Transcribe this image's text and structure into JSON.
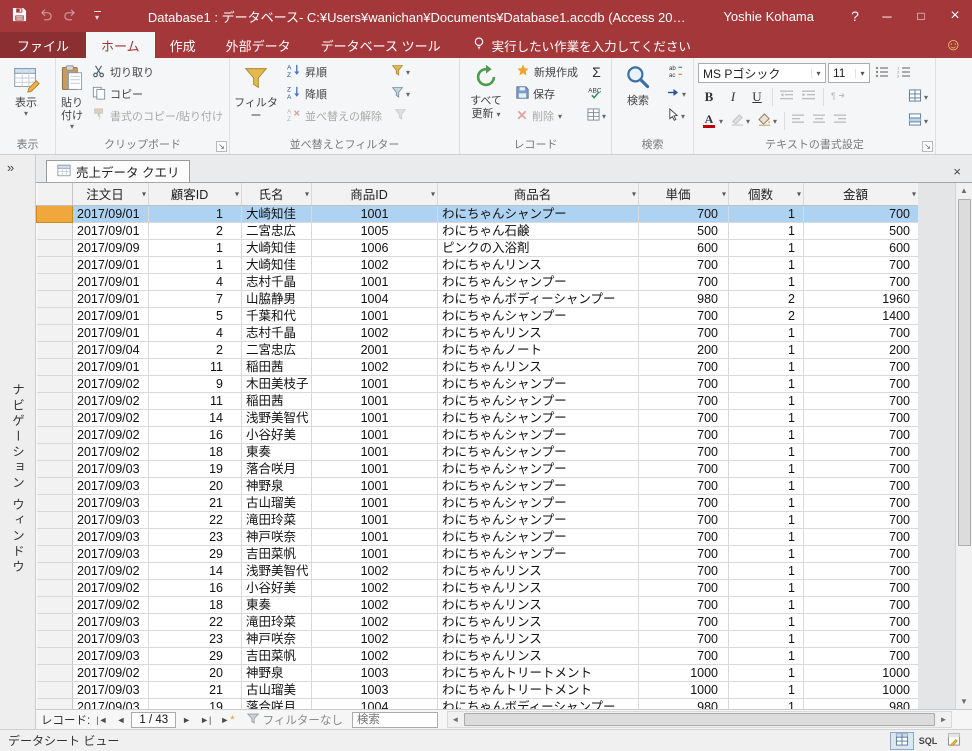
{
  "glyphs": {
    "dropdown": "▾",
    "up": "▲",
    "down": "▼",
    "left": "◄",
    "right": "►",
    "bar": "|",
    "launcher": "↘",
    "chevron_expand": "»",
    "smiley": "☺"
  },
  "titlebar": {
    "title": "Database1 : データベース- C:¥Users¥wanichan¥Documents¥Database1.accdb (Access 20…",
    "user": "Yoshie Kohama",
    "help": "?",
    "minimize": "─",
    "maximize": "□",
    "close": "×"
  },
  "ribbon": {
    "tabs": {
      "file": "ファイル",
      "home": "ホーム",
      "create": "作成",
      "external": "外部データ",
      "tools": "データベース ツール"
    },
    "tellme": "実行したい作業を入力してください",
    "view_group": {
      "label": "表示",
      "view": "表示"
    },
    "clipboard_group": {
      "label": "クリップボード",
      "paste": "貼り付け",
      "cut": "切り取り",
      "copy": "コピー",
      "format_painter": "書式のコピー/貼り付け"
    },
    "sort_group": {
      "label": "並べ替えとフィルター",
      "filter": "フィルター",
      "asc": "昇順",
      "desc": "降順",
      "clear": "並べ替えの解除"
    },
    "records_group": {
      "label": "レコード",
      "refresh1": "すべて",
      "refresh2": "更新",
      "new": "新規作成",
      "save": "保存",
      "delete": "削除",
      "sum": "Σ"
    },
    "find_group": {
      "label": "検索",
      "find": "検索"
    },
    "format_group": {
      "label": "テキストの書式設定",
      "font": "MS Pゴシック",
      "size": "11",
      "bold": "B",
      "italic": "I",
      "underline": "U",
      "color": "A"
    }
  },
  "nav_pane": {
    "expand": "»",
    "label": "ナビゲーション ウィンドウ"
  },
  "document": {
    "tab_title": "売上データ クエリ",
    "close": "×"
  },
  "table": {
    "columns": [
      "注文日",
      "顧客ID",
      "氏名",
      "商品ID",
      "商品名",
      "単価",
      "個数",
      "金額"
    ],
    "selected_row_index": 0,
    "rows": [
      [
        "2017/09/01",
        "1",
        "大崎知佳",
        "1001",
        "わにちゃんシャンプー",
        "700",
        "1",
        "700"
      ],
      [
        "2017/09/01",
        "2",
        "二宮忠広",
        "1005",
        "わにちゃん石鹸",
        "500",
        "1",
        "500"
      ],
      [
        "2017/09/09",
        "1",
        "大崎知佳",
        "1006",
        "ピンクの入浴剤",
        "600",
        "1",
        "600"
      ],
      [
        "2017/09/01",
        "1",
        "大崎知佳",
        "1002",
        "わにちゃんリンス",
        "700",
        "1",
        "700"
      ],
      [
        "2017/09/01",
        "4",
        "志村千晶",
        "1001",
        "わにちゃんシャンプー",
        "700",
        "1",
        "700"
      ],
      [
        "2017/09/01",
        "7",
        "山脇静男",
        "1004",
        "わにちゃんボディーシャンプー",
        "980",
        "2",
        "1960"
      ],
      [
        "2017/09/01",
        "5",
        "千葉和代",
        "1001",
        "わにちゃんシャンプー",
        "700",
        "2",
        "1400"
      ],
      [
        "2017/09/01",
        "4",
        "志村千晶",
        "1002",
        "わにちゃんリンス",
        "700",
        "1",
        "700"
      ],
      [
        "2017/09/04",
        "2",
        "二宮忠広",
        "2001",
        "わにちゃんノート",
        "200",
        "1",
        "200"
      ],
      [
        "2017/09/01",
        "11",
        "稲田茜",
        "1002",
        "わにちゃんリンス",
        "700",
        "1",
        "700"
      ],
      [
        "2017/09/02",
        "9",
        "木田美枝子",
        "1001",
        "わにちゃんシャンプー",
        "700",
        "1",
        "700"
      ],
      [
        "2017/09/02",
        "11",
        "稲田茜",
        "1001",
        "わにちゃんシャンプー",
        "700",
        "1",
        "700"
      ],
      [
        "2017/09/02",
        "14",
        "浅野美智代",
        "1001",
        "わにちゃんシャンプー",
        "700",
        "1",
        "700"
      ],
      [
        "2017/09/02",
        "16",
        "小谷好美",
        "1001",
        "わにちゃんシャンプー",
        "700",
        "1",
        "700"
      ],
      [
        "2017/09/02",
        "18",
        "東奏",
        "1001",
        "わにちゃんシャンプー",
        "700",
        "1",
        "700"
      ],
      [
        "2017/09/03",
        "19",
        "落合咲月",
        "1001",
        "わにちゃんシャンプー",
        "700",
        "1",
        "700"
      ],
      [
        "2017/09/03",
        "20",
        "神野泉",
        "1001",
        "わにちゃんシャンプー",
        "700",
        "1",
        "700"
      ],
      [
        "2017/09/03",
        "21",
        "古山瑠美",
        "1001",
        "わにちゃんシャンプー",
        "700",
        "1",
        "700"
      ],
      [
        "2017/09/03",
        "22",
        "滝田玲菜",
        "1001",
        "わにちゃんシャンプー",
        "700",
        "1",
        "700"
      ],
      [
        "2017/09/03",
        "23",
        "神戸咲奈",
        "1001",
        "わにちゃんシャンプー",
        "700",
        "1",
        "700"
      ],
      [
        "2017/09/03",
        "29",
        "吉田菜帆",
        "1001",
        "わにちゃんシャンプー",
        "700",
        "1",
        "700"
      ],
      [
        "2017/09/02",
        "14",
        "浅野美智代",
        "1002",
        "わにちゃんリンス",
        "700",
        "1",
        "700"
      ],
      [
        "2017/09/02",
        "16",
        "小谷好美",
        "1002",
        "わにちゃんリンス",
        "700",
        "1",
        "700"
      ],
      [
        "2017/09/02",
        "18",
        "東奏",
        "1002",
        "わにちゃんリンス",
        "700",
        "1",
        "700"
      ],
      [
        "2017/09/03",
        "22",
        "滝田玲菜",
        "1002",
        "わにちゃんリンス",
        "700",
        "1",
        "700"
      ],
      [
        "2017/09/03",
        "23",
        "神戸咲奈",
        "1002",
        "わにちゃんリンス",
        "700",
        "1",
        "700"
      ],
      [
        "2017/09/03",
        "29",
        "吉田菜帆",
        "1002",
        "わにちゃんリンス",
        "700",
        "1",
        "700"
      ],
      [
        "2017/09/02",
        "20",
        "神野泉",
        "1003",
        "わにちゃんトリートメント",
        "1000",
        "1",
        "1000"
      ],
      [
        "2017/09/03",
        "21",
        "古山瑠美",
        "1003",
        "わにちゃんトリートメント",
        "1000",
        "1",
        "1000"
      ],
      [
        "2017/09/03",
        "19",
        "落合咲月",
        "1004",
        "わにちゃんボディーシャンプー",
        "980",
        "1",
        "980"
      ]
    ]
  },
  "record_nav": {
    "label": "レコード:",
    "position": "1 / 43",
    "filter_status": "フィルターなし",
    "search_placeholder": "検索",
    "new_star": "*"
  },
  "status_bar": {
    "view_label": "データシート ビュー",
    "sql": "SQL"
  }
}
